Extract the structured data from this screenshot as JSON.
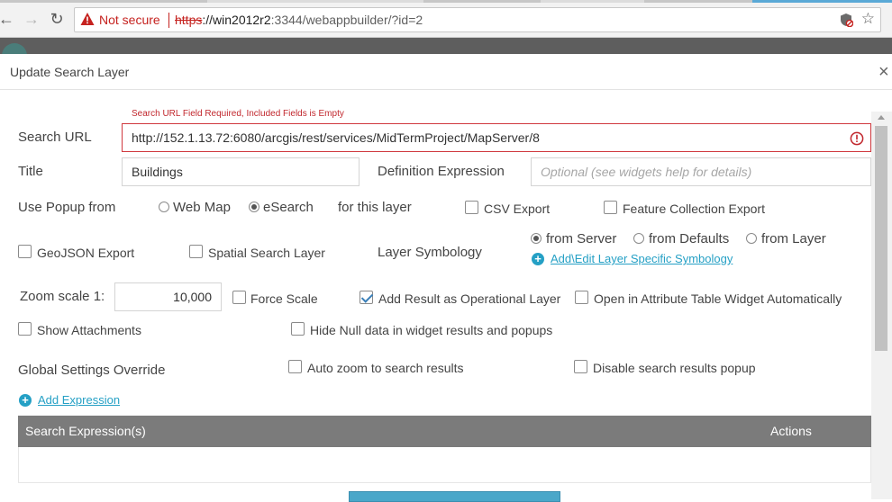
{
  "browser": {
    "security_label": "Not secure",
    "url_scheme": "https",
    "url_rest": "://win2012r2",
    "url_port_path": ":3344/webappbuilder/?id=2"
  },
  "dialog": {
    "title": "Update Search Layer",
    "close": "×"
  },
  "search_url": {
    "label": "Search URL",
    "error_message": "Search URL Field Required, Included Fields is Empty",
    "value": "http://152.1.13.72:6080/arcgis/rest/services/MidTermProject/MapServer/8"
  },
  "title_field": {
    "label": "Title",
    "value": "Buildings"
  },
  "definition_expression": {
    "label": "Definition Expression",
    "placeholder": "Optional (see widgets help for details)"
  },
  "popup": {
    "label": "Use Popup from",
    "options": [
      "Web Map",
      "eSearch"
    ],
    "selected": "eSearch",
    "suffix": "for this layer"
  },
  "checkboxes": {
    "csv_export": {
      "label": "CSV Export",
      "checked": false
    },
    "feature_collection_export": {
      "label": "Feature Collection Export",
      "checked": false
    },
    "geojson_export": {
      "label": "GeoJSON Export",
      "checked": false
    },
    "spatial_search_layer": {
      "label": "Spatial Search Layer",
      "checked": false
    },
    "force_scale": {
      "label": "Force Scale",
      "checked": false
    },
    "add_result_operational": {
      "label": "Add Result as Operational Layer",
      "checked": true
    },
    "open_attribute_table": {
      "label": "Open in Attribute Table Widget Automatically",
      "checked": false
    },
    "show_attachments": {
      "label": "Show Attachments",
      "checked": false
    },
    "hide_null": {
      "label": "Hide Null data in widget results and popups",
      "checked": false
    },
    "auto_zoom": {
      "label": "Auto zoom to search results",
      "checked": false
    },
    "disable_popup": {
      "label": "Disable search results popup",
      "checked": false
    }
  },
  "symbology": {
    "label": "Layer Symbology",
    "options": [
      "from Server",
      "from Defaults",
      "from Layer"
    ],
    "selected": "from Server",
    "link": "Add\\Edit Layer Specific Symbology"
  },
  "zoom": {
    "label": "Zoom scale 1:",
    "value": "10,000"
  },
  "global_settings": {
    "label": "Global Settings Override"
  },
  "add_expression": {
    "label": "Add Expression"
  },
  "expressions_table": {
    "columns": [
      "Search Expression(s)",
      "Actions"
    ],
    "rows": []
  },
  "colors": {
    "accent": "#25a0c5",
    "error": "#c1272d",
    "table_header": "#7b7b7b"
  }
}
